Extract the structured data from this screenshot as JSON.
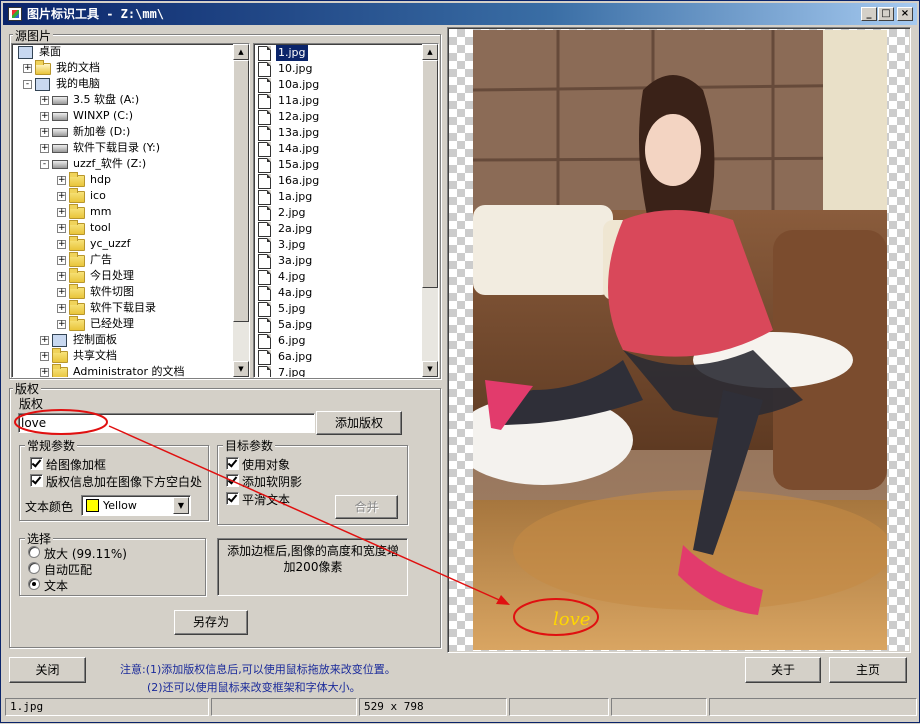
{
  "window": {
    "title": "图片标识工具 - Z:\\mm\\"
  },
  "source_panel": {
    "label": "源图片"
  },
  "tree": [
    {
      "label": "桌面",
      "depth": 0,
      "icon": "desktop-icon",
      "expander": ""
    },
    {
      "label": "我的文档",
      "depth": 1,
      "icon": "mydocs-icon",
      "expander": "+"
    },
    {
      "label": "我的电脑",
      "depth": 1,
      "icon": "computer-icon",
      "expander": "-"
    },
    {
      "label": "3.5 软盘 (A:)",
      "depth": 2,
      "icon": "floppy-icon",
      "expander": "+"
    },
    {
      "label": "WINXP (C:)",
      "depth": 2,
      "icon": "drive-icon",
      "expander": "+"
    },
    {
      "label": "新加卷 (D:)",
      "depth": 2,
      "icon": "drive-icon",
      "expander": "+"
    },
    {
      "label": "软件下载目录 (Y:)",
      "depth": 2,
      "icon": "network-drive-icon",
      "expander": "+"
    },
    {
      "label": "uzzf_软件 (Z:)",
      "depth": 2,
      "icon": "network-drive-icon",
      "expander": "-"
    },
    {
      "label": "hdp",
      "depth": 3,
      "icon": "folder-icon",
      "expander": "+"
    },
    {
      "label": "ico",
      "depth": 3,
      "icon": "folder-icon",
      "expander": "+"
    },
    {
      "label": "mm",
      "depth": 3,
      "icon": "folder-icon",
      "expander": "+"
    },
    {
      "label": "tool",
      "depth": 3,
      "icon": "folder-icon",
      "expander": "+"
    },
    {
      "label": "yc_uzzf",
      "depth": 3,
      "icon": "folder-icon",
      "expander": "+"
    },
    {
      "label": "广告",
      "depth": 3,
      "icon": "folder-icon",
      "expander": "+"
    },
    {
      "label": "今日处理",
      "depth": 3,
      "icon": "folder-icon",
      "expander": "+"
    },
    {
      "label": "软件切图",
      "depth": 3,
      "icon": "folder-icon",
      "expander": "+"
    },
    {
      "label": "软件下载目录",
      "depth": 3,
      "icon": "folder-icon",
      "expander": "+"
    },
    {
      "label": "已经处理",
      "depth": 3,
      "icon": "folder-icon",
      "expander": "+"
    },
    {
      "label": "控制面板",
      "depth": 2,
      "icon": "control-panel-icon",
      "expander": "+"
    },
    {
      "label": "共享文档",
      "depth": 2,
      "icon": "folder-icon",
      "expander": "+"
    },
    {
      "label": "Administrator 的文档",
      "depth": 2,
      "icon": "folder-icon",
      "expander": "+"
    }
  ],
  "files": [
    "1.jpg",
    "10.jpg",
    "10a.jpg",
    "11a.jpg",
    "12a.jpg",
    "13a.jpg",
    "14a.jpg",
    "15a.jpg",
    "16a.jpg",
    "1a.jpg",
    "2.jpg",
    "2a.jpg",
    "3.jpg",
    "3a.jpg",
    "4.jpg",
    "4a.jpg",
    "5.jpg",
    "5a.jpg",
    "6.jpg",
    "6a.jpg",
    "7.jpg"
  ],
  "selected_file_index": 0,
  "copyright": {
    "section_label": "版权",
    "field_label": "版权",
    "input_value": "love",
    "add_button": "添加版权"
  },
  "general_params": {
    "label": "常规参数",
    "add_frame": {
      "label": "给图像加框",
      "checked": true
    },
    "below_image": {
      "label": "版权信息加在图像下方空白处",
      "checked": true
    },
    "text_color_label": "文本颜色",
    "text_color_value": "Yellow",
    "text_color_hex": "#ffff00"
  },
  "target_params": {
    "label": "目标参数",
    "use_object": {
      "label": "使用对象",
      "checked": true
    },
    "soft_shadow": {
      "label": "添加软阴影",
      "checked": true
    },
    "smooth_text": {
      "label": "平滑文本",
      "checked": true
    },
    "merge_button": "合并"
  },
  "selection": {
    "label": "选择",
    "options": [
      {
        "label": "放大 (99.11%)",
        "checked": false
      },
      {
        "label": "自动匹配",
        "checked": false
      },
      {
        "label": "文本",
        "checked": true
      }
    ]
  },
  "info_text": "添加边框后,图像的高度和宽度增加200像素",
  "save_as_button": "另存为",
  "close_button": "关闭",
  "about_button": "关于",
  "home_button": "主页",
  "notes": [
    "注意:(1)添加版权信息后,可以使用鼠标拖放来改变位置。",
    "(2)还可以使用鼠标来改变框架和字体大小。"
  ],
  "preview": {
    "watermark_text": "love",
    "annotation_color": "#e01010"
  },
  "statusbar": {
    "file": "1.jpg",
    "size": "529 x 798"
  },
  "colors": {
    "title_start": "#0a246a",
    "selection": "#0a246a",
    "watermark": "#ffd700"
  }
}
